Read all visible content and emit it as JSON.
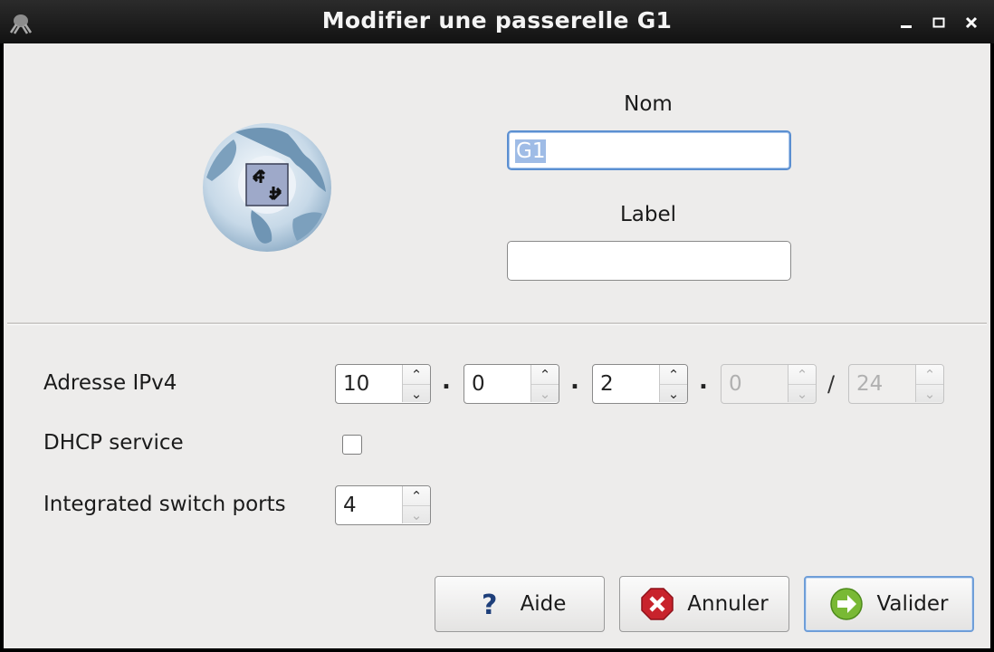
{
  "window": {
    "title": "Modifier une passerelle G1"
  },
  "form": {
    "name_label": "Nom",
    "name_value": "G1",
    "label_label": "Label",
    "label_value": ""
  },
  "network": {
    "ipv4_label": "Adresse IPv4",
    "ipv4_octets": [
      "10",
      "0",
      "2",
      "0"
    ],
    "prefix_separator": "/",
    "prefix": "24",
    "dhcp_label": "DHCP service",
    "dhcp_checked": false,
    "switch_ports_label": "Integrated switch ports",
    "switch_ports": "4"
  },
  "buttons": {
    "help": "Aide",
    "cancel": "Annuler",
    "ok": "Valider"
  },
  "icons": {
    "app": "app-icon",
    "logo": "router-globe-icon",
    "help": "question-icon",
    "cancel": "cancel-icon",
    "ok": "arrow-right-icon"
  }
}
